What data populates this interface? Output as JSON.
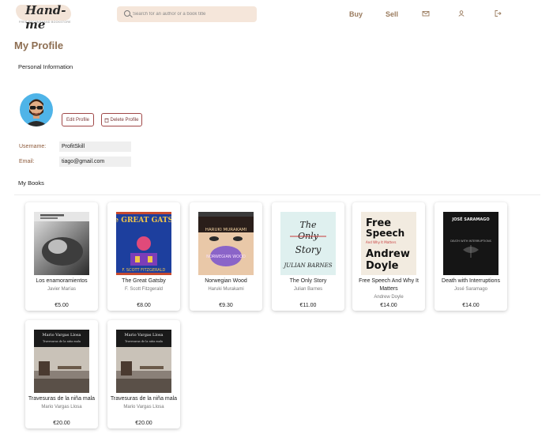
{
  "header": {
    "logo_text": "Hand-me",
    "logo_tagline": "FREE SECONDHAND BOOKSTORE",
    "search_placeholder": "Search for an author or a book title",
    "nav": {
      "buy": "Buy",
      "sell": "Sell"
    },
    "icons": [
      "mail-icon",
      "user-icon",
      "logout-icon"
    ]
  },
  "page": {
    "title": "My Profile"
  },
  "personal": {
    "section_label": "Personal Information",
    "edit_label": "Edit Profile",
    "delete_label": "Delete Profile",
    "username_label": "Username:",
    "username_value": "ProfitSkill",
    "email_label": "Email:",
    "email_value": "tiago@gmail.com"
  },
  "books_section": {
    "label": "My Books"
  },
  "books": [
    {
      "title": "Los enamoramientos",
      "author": "Javier Marías",
      "price": "€5.00"
    },
    {
      "title": "The Great Gatsby",
      "author": "F. Scott Fitzgerald",
      "price": "€8.00",
      "cover_title": "The GREAT GATSBY",
      "cover_author": "F. SCOTT FITZGERALD"
    },
    {
      "title": "Norwegian Wood",
      "author": "Haruki Murakami",
      "price": "€9.30",
      "cover_author": "HARUKI MURAKAMI",
      "cover_title": "NORWEGIAN WOOD"
    },
    {
      "title": "The Only Story",
      "author": "Julian Barnes",
      "price": "€11.00",
      "cover_title_1": "The",
      "cover_title_2": "Only",
      "cover_title_3": "Story",
      "cover_author": "JULIAN BARNES"
    },
    {
      "title": "Free Speech And Why It Matters",
      "author": "Andrew Doyle",
      "price": "€14.00",
      "cover_title_1": "Free",
      "cover_title_2": "Speech",
      "cover_sub": "And Why It Matters",
      "cover_author_1": "Andrew",
      "cover_author_2": "Doyle"
    },
    {
      "title": "Death with Interruptions",
      "author": "José Saramago",
      "price": "€14.00",
      "cover_author": "JOSÉ SARAMAGO",
      "cover_title": "DEATH WITH INTERRUPTIONS"
    },
    {
      "title": "Travesuras de la niña mala",
      "author": "Mario Vargas Llosa",
      "price": "€20.00",
      "cover_author": "Mario Vargas Llosa",
      "cover_title": "Travesuras de la niña mala"
    },
    {
      "title": "Travesuras de la niña mala",
      "author": "Mario Vargas Llosa",
      "price": "€20.00",
      "cover_author": "Mario Vargas Llosa",
      "cover_title": "Travesuras de la niña mala"
    }
  ],
  "colors": {
    "accent": "#9a7b5e",
    "danger_border": "#a04848",
    "search_bg": "#f5e6da"
  }
}
